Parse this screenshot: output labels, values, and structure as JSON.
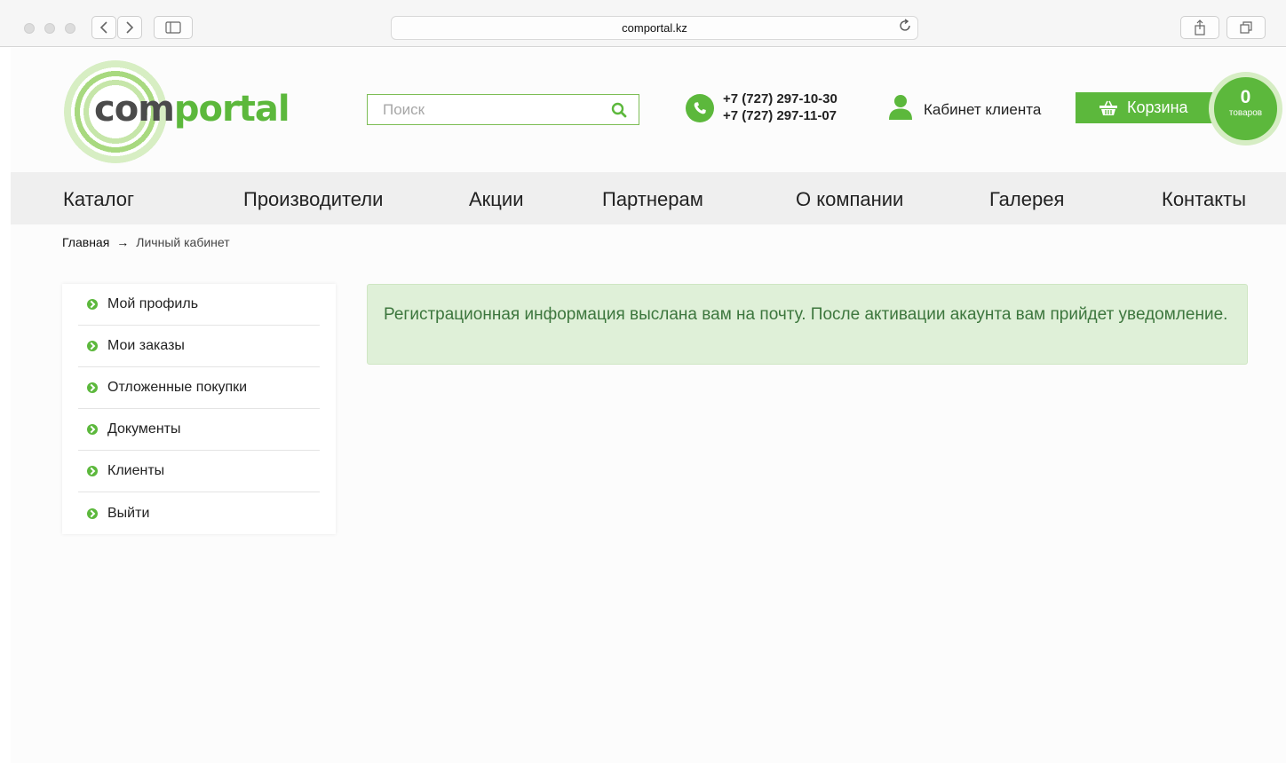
{
  "browser": {
    "url": "comportal.kz"
  },
  "header": {
    "logo_com": "com",
    "logo_portal": "portal",
    "search_placeholder": "Поиск",
    "phones": [
      "+7 (727) 297-10-30",
      "+7 (727) 297-11-07"
    ],
    "cabinet_label": "Кабинет клиента",
    "cart_label": "Корзина",
    "cart_count": "0",
    "cart_count_label": "товаров"
  },
  "nav": {
    "items": [
      "Каталог",
      "Производители",
      "Акции",
      "Партнерам",
      "О компании",
      "Галерея",
      "Контакты"
    ]
  },
  "breadcrumb": {
    "home": "Главная",
    "arrow": "→",
    "current": "Личный кабинет"
  },
  "sidebar": {
    "items": [
      "Мой профиль",
      "Мои заказы",
      "Отложенные покупки",
      "Документы",
      "Клиенты",
      "Выйти"
    ]
  },
  "alert": {
    "message": "Регистрационная информация выслана вам на почту. После активации акаунта вам прийдет уведомление."
  },
  "colors": {
    "brand_green": "#5cb83c",
    "alert_bg": "#dff0d8",
    "alert_text": "#3c763d"
  },
  "icons": [
    "sidebar-toggle-icon",
    "back-icon",
    "forward-icon",
    "reload-icon",
    "share-icon",
    "tabs-icon",
    "search-icon",
    "phone-icon",
    "user-icon",
    "basket-icon",
    "chevron-right-circle-icon"
  ]
}
